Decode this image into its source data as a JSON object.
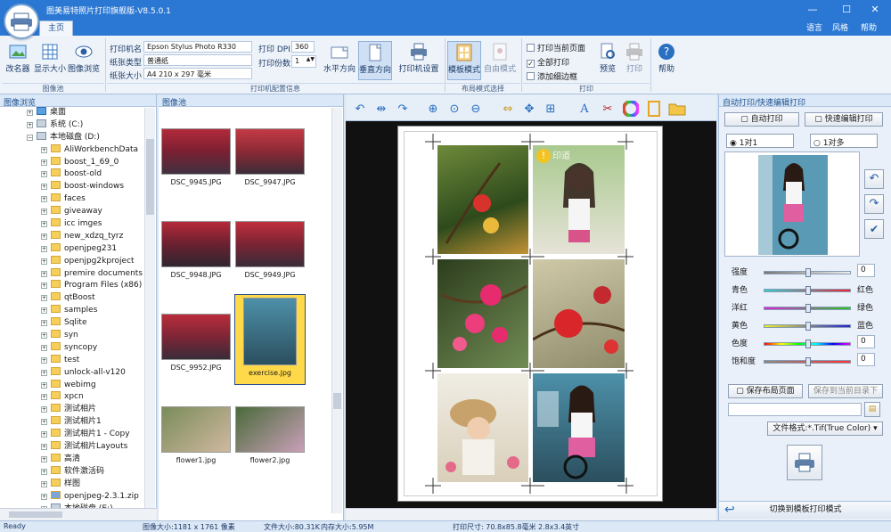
{
  "window": {
    "title": "图美易特照片打印旗舰版-V8.5.0.1",
    "min": "—",
    "max": "☐",
    "close": "✕"
  },
  "menu": {
    "tab_main": "主页",
    "language": "语言",
    "style": "风格",
    "help": "帮助"
  },
  "ribbon": {
    "rename": "改名器",
    "show_size": "显示大小",
    "image_browse": "图像浏览",
    "group_pool": "图像池",
    "printer_name_label": "打印机名",
    "printer_name": "Epson Stylus Photo R330",
    "paper_type_label": "纸张类型",
    "paper_type": "普通纸",
    "paper_size_label": "纸张大小",
    "paper_size": "A4 210 x 297 毫米",
    "dpi_label": "打印 DPI:",
    "dpi": "360",
    "copies_label": "打印份数",
    "copies": "1",
    "horizontal": "水平方向",
    "vertical": "垂直方向",
    "printer_settings": "打印机设置",
    "group_printer": "打印机配置信息",
    "template_mode": "模板模式",
    "free_mode": "自由模式",
    "group_layout": "布局模式选择",
    "print_current": "打印当前页面",
    "print_all": "全部打印",
    "add_border": "添加细边框",
    "preview": "预览",
    "print": "打印",
    "group_print": "打印",
    "help": "帮助"
  },
  "tree": {
    "title": "图像浏览",
    "items": [
      "桌面",
      "系统 (C:)",
      "本地磁盘 (D:)",
      "AliWorkbenchData",
      "boost_1_69_0",
      "boost-old",
      "boost-windows",
      "faces",
      "giveaway",
      "icc imges",
      "new_xdzq_tyrz",
      "openjpeg231",
      "openjpg2kproject",
      "premire documents",
      "Program Files (x86)",
      "qtBoost",
      "samples",
      "Sqlite",
      "syn",
      "syncopy",
      "test",
      "unlock-all-v120",
      "webimg",
      "xpcn",
      "测试相片",
      "测试相片1",
      "测试相片1 - Copy",
      "测试相片Layouts",
      "高清",
      "软件激活码",
      "样图",
      "openjpeg-2.3.1.zip",
      "本地磁盘 (E:)"
    ]
  },
  "pool": {
    "title": "图像池",
    "thumbs": [
      "DSC_9945.JPG",
      "DSC_9947.JPG",
      "DSC_9948.JPG",
      "DSC_9949.JPG",
      "DSC_9952.JPG",
      "exercise.jpg",
      "flower1.jpg",
      "flower2.jpg"
    ]
  },
  "right": {
    "title": "自动打印/快速编辑打印",
    "auto_print": "自动打印",
    "quick_edit": "快速编辑打印",
    "one_to_one": "1对1",
    "one_to_many": "1对多",
    "brightness": "强度",
    "cyan": "青色",
    "red": "红色",
    "magenta": "洋红",
    "green": "绿色",
    "yellow": "黄色",
    "blue": "蓝色",
    "hue": "色度",
    "saturation": "饱和度",
    "zero1": "0",
    "zero2": "0",
    "zero3": "0",
    "save_layout": "保存布局页面",
    "save_to_dir": "保存到当前目录下",
    "file_format": "文件格式:*.Tif(True Color)",
    "switch_template": "切换到模板打印模式"
  },
  "canvas": {
    "watermark": "印道"
  },
  "status": {
    "ready": "Ready",
    "image_size": "图像大小:1181 x 1761 像素",
    "file_size": "文件大小:80.31K",
    "memory": "内存大小:5.95M",
    "print_size": "打印尺寸: 70.8x85.8毫米",
    "inch_size": "2.8x3.4英寸"
  },
  "colors": {
    "accent": "#2b78d4",
    "selected": "#ffd94a",
    "panel": "#e9f0f9"
  }
}
